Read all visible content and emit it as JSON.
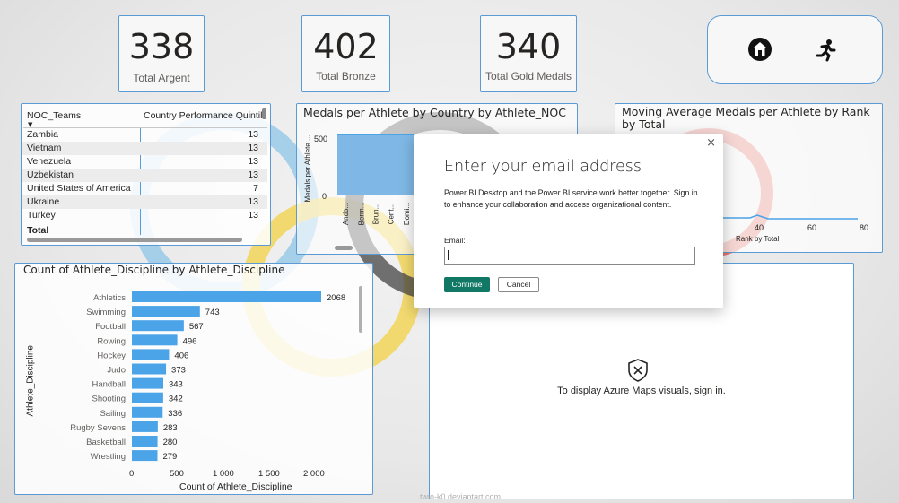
{
  "kpis": [
    {
      "value": "338",
      "label": "Total Argent"
    },
    {
      "value": "402",
      "label": "Total Bronze"
    },
    {
      "value": "340",
      "label": "Total Gold Medals"
    }
  ],
  "nav": {
    "home_icon": "home-icon",
    "athlete_icon": "running-athlete-icon"
  },
  "table": {
    "col1": "NOC_Teams",
    "col2": "Country Performance Quintile",
    "rows": [
      {
        "name": "Zambia",
        "value": "13"
      },
      {
        "name": "Vietnam",
        "value": "13"
      },
      {
        "name": "Venezuela",
        "value": "13"
      },
      {
        "name": "Uzbekistan",
        "value": "13"
      },
      {
        "name": "United States of America",
        "value": "7"
      },
      {
        "name": "Ukraine",
        "value": "13"
      },
      {
        "name": "Turkey",
        "value": "13"
      }
    ],
    "total": "Total"
  },
  "medals_chart": {
    "title": "Medals per Athlete by Country by Athlete_NOC",
    "ylabel": "Medals per Athlete ...",
    "yticks": [
      "500",
      "0"
    ],
    "xlabels": [
      "Ando...",
      "Berm...",
      "Brun...",
      "Cent...",
      "Domi..."
    ]
  },
  "moving_avg": {
    "title": "Moving Average Medals per Athlete by Rank by Total",
    "xticks": [
      "40",
      "60",
      "80"
    ],
    "xlabel": "Rank by Total"
  },
  "discipline_chart": {
    "title": "Count of Athlete_Discipline by Athlete_Discipline",
    "xlabel": "Count of Athlete_Discipline",
    "ylabel": "Athlete_Discipline",
    "xticks": [
      "0",
      "500",
      "1 000",
      "1 500",
      "2 000"
    ]
  },
  "chart_data": {
    "type": "bar",
    "orientation": "horizontal",
    "title": "Count of Athlete_Discipline by Athlete_Discipline",
    "xlabel": "Count of Athlete_Discipline",
    "ylabel": "Athlete_Discipline",
    "categories": [
      "Athletics",
      "Swimming",
      "Football",
      "Rowing",
      "Hockey",
      "Judo",
      "Handball",
      "Shooting",
      "Sailing",
      "Rugby Sevens",
      "Basketball",
      "Wrestling"
    ],
    "values": [
      2068,
      743,
      567,
      496,
      406,
      373,
      343,
      342,
      336,
      283,
      280,
      279
    ],
    "xlim": [
      0,
      2200
    ],
    "color": "#4ba3e8"
  },
  "map": {
    "message": "To display Azure Maps visuals, sign in.",
    "icon": "shield-x-icon"
  },
  "dialog": {
    "title": "Enter your email address",
    "body": "Power BI Desktop and the Power BI service work better together. Sign in to enhance your collaboration and access organizational content.",
    "email_label": "Email:",
    "email_value": "",
    "continue": "Continue",
    "cancel": "Cancel"
  },
  "watermark": "twin-k0.deviantart.com",
  "colors": {
    "accent": "#5b9bd5",
    "bar": "#4ba3e8",
    "primary_button": "#117865"
  }
}
